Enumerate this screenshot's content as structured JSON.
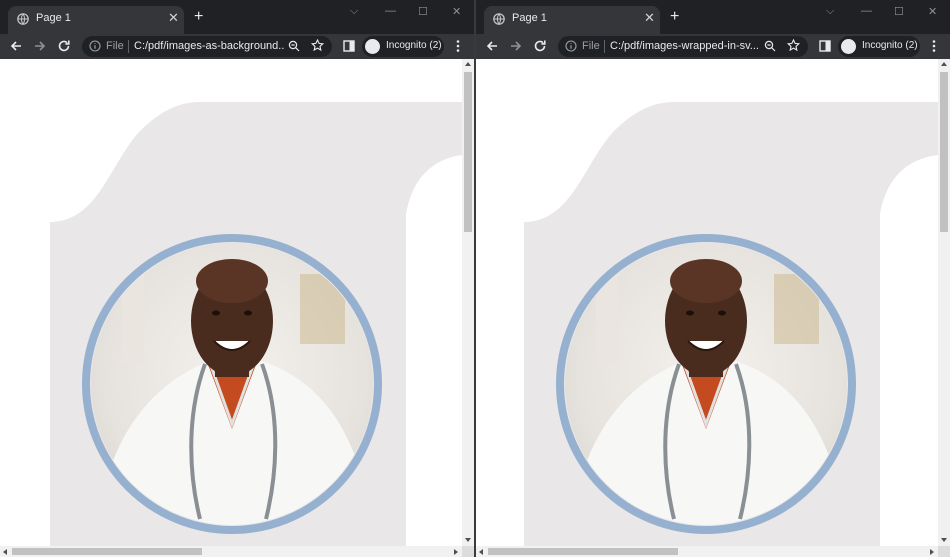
{
  "windows": [
    {
      "tab_title": "Page 1",
      "file_label": "File",
      "url": "C:/pdf/images-as-background...",
      "incognito_label": "Incognito (2)"
    },
    {
      "tab_title": "Page 1",
      "file_label": "File",
      "url": "C:/pdf/images-wrapped-in-sv...",
      "incognito_label": "Incognito (2)"
    }
  ],
  "colors": {
    "tabstrip": "#202124",
    "toolbar": "#35363a",
    "shape_gray": "#e9e7e8",
    "ring_blue": "#96b0d0"
  },
  "icons": [
    "globe-icon",
    "close-icon",
    "plus-icon",
    "back-icon",
    "forward-icon",
    "reload-icon",
    "info-icon",
    "zoom-icon",
    "star-icon",
    "side-panel-icon",
    "incognito-icon",
    "menu-icon"
  ]
}
